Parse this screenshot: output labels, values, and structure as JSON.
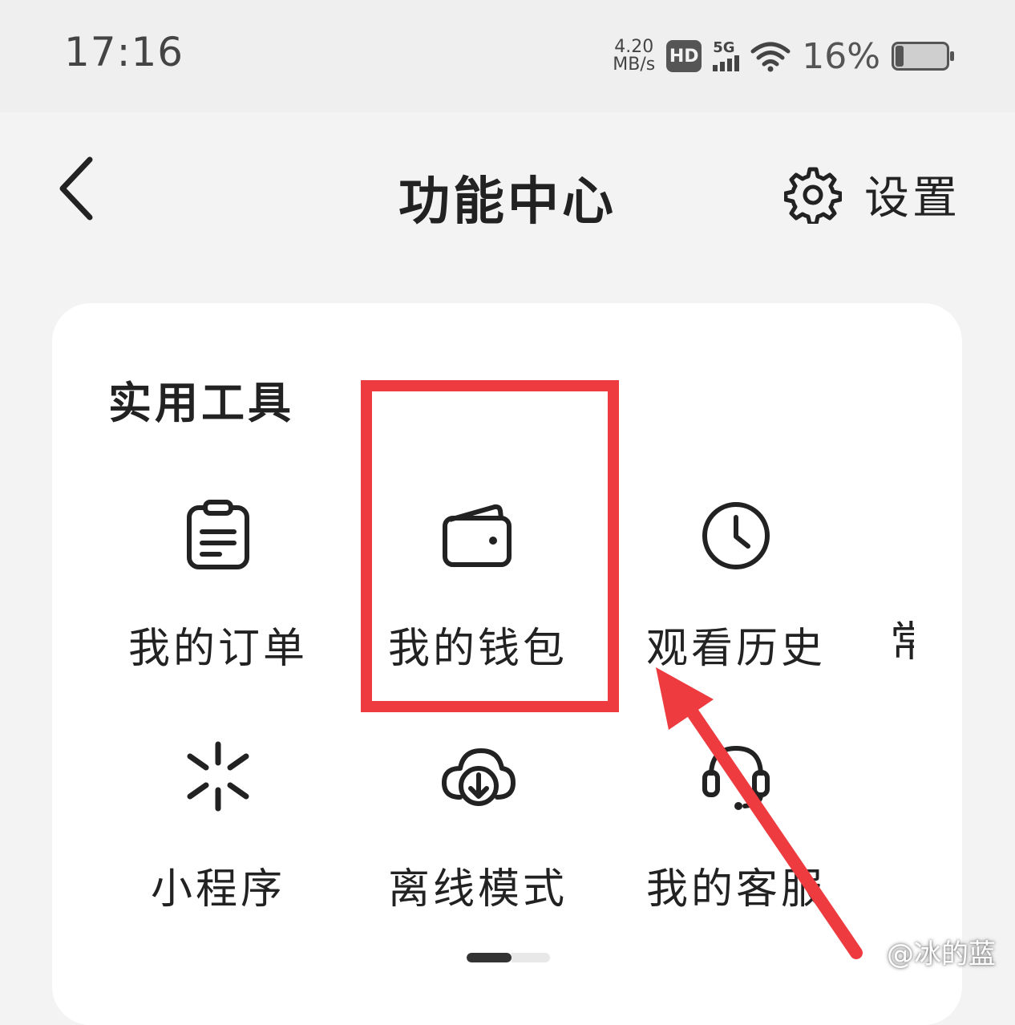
{
  "status_bar": {
    "time": "17:16",
    "net_speed_value": "4.20",
    "net_speed_unit": "MB/s",
    "hd_label": "HD",
    "signal_label": "5G",
    "battery_percent": "16%"
  },
  "header": {
    "title": "功能中心",
    "settings_label": "设置"
  },
  "section": {
    "title": "实用工具",
    "tiles": [
      {
        "label": "我的订单",
        "icon": "clipboard-icon"
      },
      {
        "label": "我的钱包",
        "icon": "wallet-icon"
      },
      {
        "label": "观看历史",
        "icon": "clock-icon"
      },
      {
        "label": "小程序",
        "icon": "mini-program-icon"
      },
      {
        "label": "离线模式",
        "icon": "cloud-download-icon"
      },
      {
        "label": "我的客服",
        "icon": "headset-icon"
      }
    ],
    "partial_tile_label": "常"
  },
  "annotation": {
    "color": "#ee3b3f"
  },
  "watermark": {
    "text": "@冰的蓝"
  }
}
